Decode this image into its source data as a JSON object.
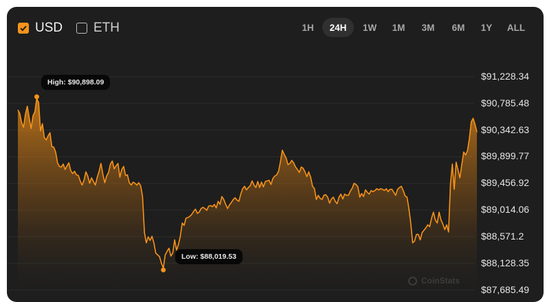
{
  "currencies": [
    {
      "label": "USD",
      "checked": true
    },
    {
      "label": "ETH",
      "checked": false
    }
  ],
  "timeframes": [
    {
      "label": "1H",
      "active": false
    },
    {
      "label": "24H",
      "active": true
    },
    {
      "label": "1W",
      "active": false
    },
    {
      "label": "1M",
      "active": false
    },
    {
      "label": "3M",
      "active": false
    },
    {
      "label": "6M",
      "active": false
    },
    {
      "label": "1Y",
      "active": false
    },
    {
      "label": "ALL",
      "active": false
    }
  ],
  "watermark": "CoinStats",
  "colors": {
    "accent": "#f7931a",
    "background": "#1e1e1e",
    "grid": "#2c2c2c"
  },
  "chart_data": {
    "type": "area",
    "ylim": [
      87685.49,
      91228.34
    ],
    "y_ticks": [
      "$91,228.34",
      "$90,785.48",
      "$90,342.63",
      "$89,899.77",
      "$89,456.92",
      "$89,014.06",
      "$88,571.2",
      "$88,128.35",
      "$87,685.49"
    ],
    "grid": true,
    "high_label": "High: $90,898.09",
    "low_label": "Low: $88,019.53",
    "high": 90898.09,
    "low": 88019.53,
    "values": [
      90680,
      90620,
      90470,
      90390,
      90610,
      90740,
      90550,
      90370,
      90580,
      90650,
      90870,
      90800,
      90330,
      90450,
      90220,
      90180,
      90250,
      90300,
      90070,
      90060,
      89980,
      89800,
      89740,
      89730,
      89780,
      89690,
      89750,
      89800,
      89670,
      89620,
      89660,
      89600,
      89590,
      89500,
      89430,
      89510,
      89650,
      89580,
      89460,
      89550,
      89490,
      89430,
      89560,
      89660,
      89790,
      89610,
      89470,
      89580,
      89640,
      89780,
      89830,
      89700,
      89750,
      89790,
      89560,
      89690,
      89740,
      89590,
      89600,
      89470,
      89430,
      89480,
      89460,
      89430,
      89470,
      89420,
      89240,
      88640,
      88470,
      88570,
      88510,
      88580,
      88470,
      88300,
      88270,
      88240,
      88130,
      88050,
      88270,
      88330,
      88380,
      88250,
      88300,
      88520,
      88350,
      88440,
      88580,
      88800,
      88760,
      88880,
      88890,
      88910,
      88940,
      88990,
      89030,
      88960,
      88980,
      89040,
      89060,
      89040,
      89010,
      89080,
      89090,
      89070,
      89110,
      89050,
      89160,
      89110,
      89240,
      89190,
      89110,
      89040,
      89100,
      89140,
      89190,
      89220,
      89180,
      89160,
      89280,
      89370,
      89410,
      89350,
      89390,
      89420,
      89500,
      89430,
      89390,
      89490,
      89390,
      89480,
      89400,
      89490,
      89500,
      89510,
      89440,
      89540,
      89580,
      89600,
      89660,
      89820,
      90010,
      89940,
      89880,
      89770,
      89790,
      89840,
      89800,
      89730,
      89690,
      89640,
      89730,
      89710,
      89650,
      89570,
      89650,
      89560,
      89410,
      89370,
      89190,
      89260,
      89210,
      89190,
      89260,
      89270,
      89230,
      89130,
      89200,
      89230,
      89160,
      89120,
      89230,
      89280,
      89200,
      89280,
      89260,
      89260,
      89330,
      89380,
      89460,
      89440,
      89400,
      89230,
      89290,
      89240,
      89350,
      89310,
      89280,
      89340,
      89320,
      89340,
      89370,
      89350,
      89370,
      89360,
      89340,
      89370,
      89320,
      89360,
      89360,
      89310,
      89260,
      89360,
      89390,
      89410,
      89340,
      89250,
      89230,
      89040,
      88790,
      88470,
      88500,
      88610,
      88610,
      88520,
      88640,
      88680,
      88720,
      88770,
      88740,
      88880,
      88980,
      88850,
      88800,
      88980,
      88850,
      88780,
      88690,
      88770,
      88650,
      89450,
      89780,
      89360,
      89810,
      89680,
      89550,
      89770,
      89980,
      89930,
      90000,
      90200,
      90480,
      90540,
      90440,
      90310
    ]
  }
}
